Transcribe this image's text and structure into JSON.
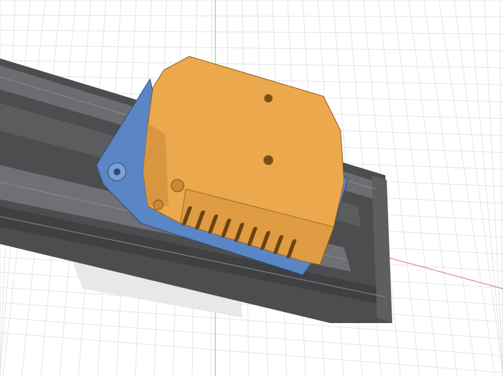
{
  "viewport": {
    "colors": {
      "background": "#ffffff",
      "grid": "#e2e4e8",
      "x_axis": "#e06a6a",
      "y_axis": "#6fcf6f",
      "rail": "#4b4d4f",
      "rail_light": "#8a8c8e",
      "bracket": "#5b86c5",
      "housing": "#eca84c",
      "housing_shade": "#c98a36"
    }
  }
}
